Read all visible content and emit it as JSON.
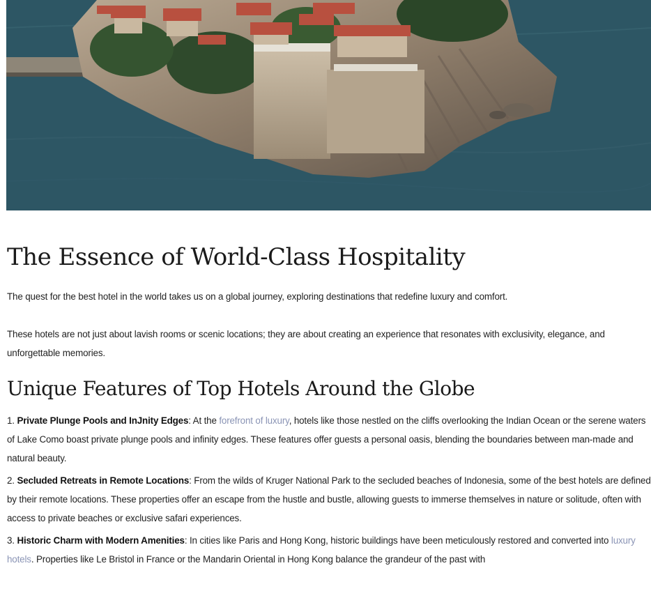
{
  "hero": {
    "icon": "island-photo"
  },
  "article": {
    "title": "The Essence of World-Class Hospitality",
    "intro": [
      "The quest for the best hotel in the world takes us on a global journey, exploring destinations that redefine luxury and comfort.",
      "These hotels are not just about lavish rooms or scenic locations; they are about creating an experience that resonates with exclusivity, elegance, and unforgettable memories."
    ],
    "section_title": "Unique Features of Top Hotels Around the Globe",
    "items": [
      {
        "number": "1. ",
        "heading": "Private Plunge Pools and InJnity Edges",
        "pre": ": At the ",
        "link": "forefront of luxury",
        "post": ", hotels like those nestled on the cliffs overlooking the Indian Ocean or the serene waters of Lake Como boast private plunge pools and infinity edges. These features offer guests a personal oasis, blending the boundaries between man-made and natural beauty."
      },
      {
        "number": "2. ",
        "heading": "Secluded Retreats in Remote Locations",
        "text": ": From the wilds of Kruger National Park to the secluded beaches of Indonesia, some of the best hotels are defined by their remote locations. These properties offer an escape from the hustle and bustle, allowing guests to immerse themselves in nature or solitude, often with access to private beaches or exclusive safari experiences."
      },
      {
        "number": "3. ",
        "heading": "Historic Charm with Modern Amenities",
        "pre": ": In cities like Paris and Hong Kong, historic buildings have been meticulously restored and converted into ",
        "link": "luxury hotels",
        "post": ". Properties like Le Bristol in France or the Mandarin Oriental in Hong Kong balance the grandeur of the past with"
      }
    ]
  }
}
